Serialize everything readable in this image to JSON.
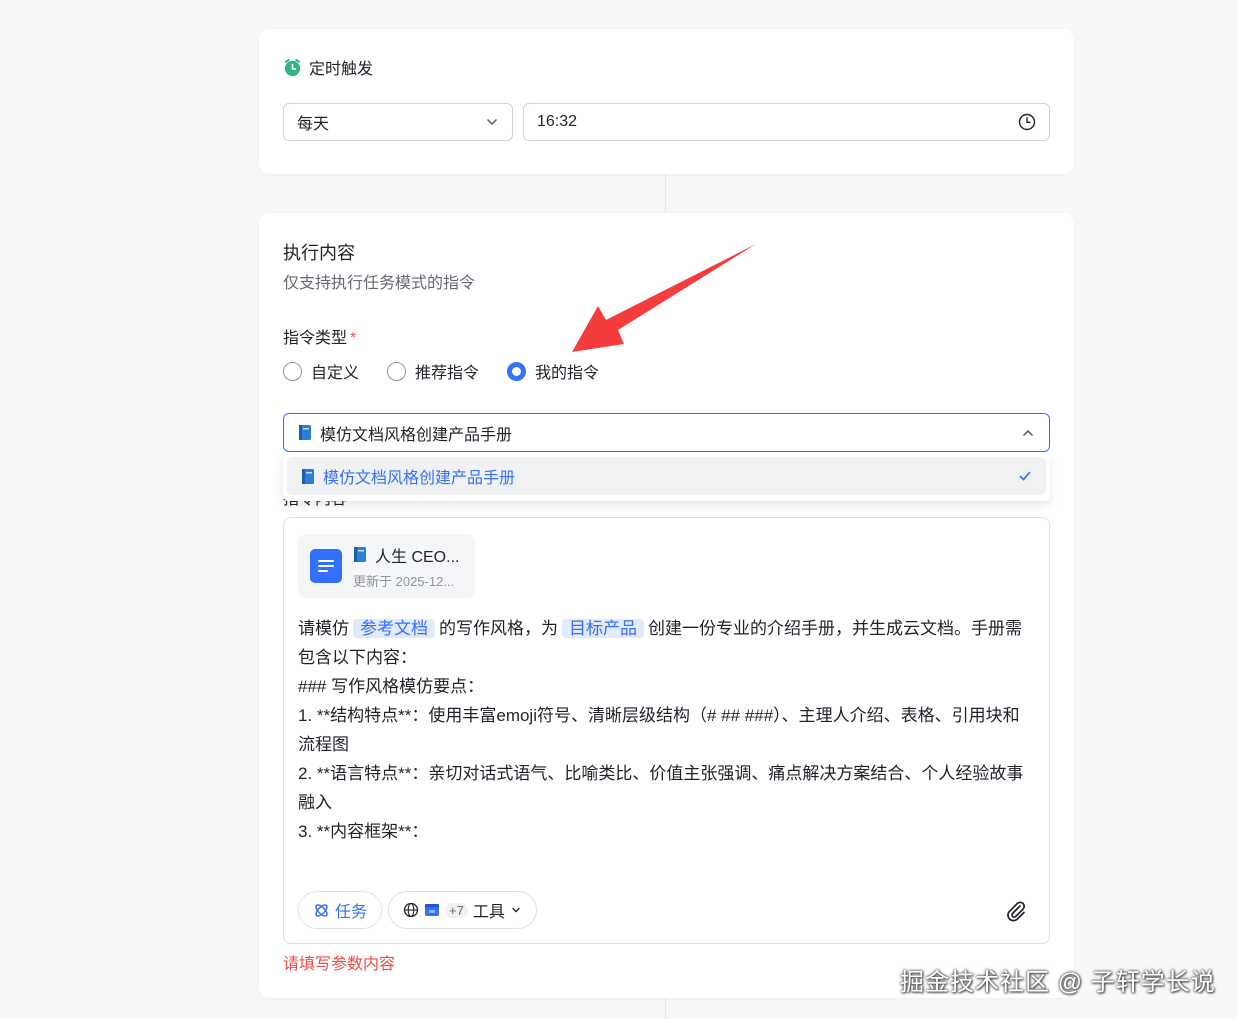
{
  "trigger": {
    "title": "定时触发",
    "frequency": "每天",
    "time": "16:32"
  },
  "content": {
    "title": "执行内容",
    "subtitle": "仅支持执行任务模式的指令",
    "type_label": "指令类型",
    "required_mark": "*",
    "radios": [
      {
        "label": "自定义",
        "checked": false
      },
      {
        "label": "推荐指令",
        "checked": false
      },
      {
        "label": "我的指令",
        "checked": true
      }
    ],
    "select_value": "模仿文档风格创建产品手册",
    "dropdown_option": "模仿文档风格创建产品手册",
    "behind_label": "指令内容",
    "doc_card": {
      "title": "人生 CEO...",
      "date": "更新于 2025-12..."
    },
    "body": {
      "p1_a": "请模仿",
      "tag1": "参考文档",
      "p1_b": "的写作风格，为",
      "tag2": "目标产品",
      "p1_c": "创建一份专业的介绍手册，并生成云文档。手册需包含以下内容：",
      "rest": "\n### 写作风格模仿要点：\n1. **结构特点**：使用丰富emoji符号、清晰层级结构（# ## ###）、主理人介绍、表格、引用块和流程图\n2. **语言特点**：亲切对话式语气、比喻类比、价值主张强调、痛点解决方案结合、个人经验故事融入\n3. **内容框架**："
    },
    "task_pill": "任务",
    "tools_count": "+7",
    "tools_label": "工具",
    "error": "请填写参数内容"
  },
  "watermark": "掘金技术社区 @ 子轩学长说",
  "colors": {
    "accent": "#3370ff",
    "error": "#f54a45",
    "arrow": "#f53c3c",
    "clock_green": "#2fb57f"
  }
}
